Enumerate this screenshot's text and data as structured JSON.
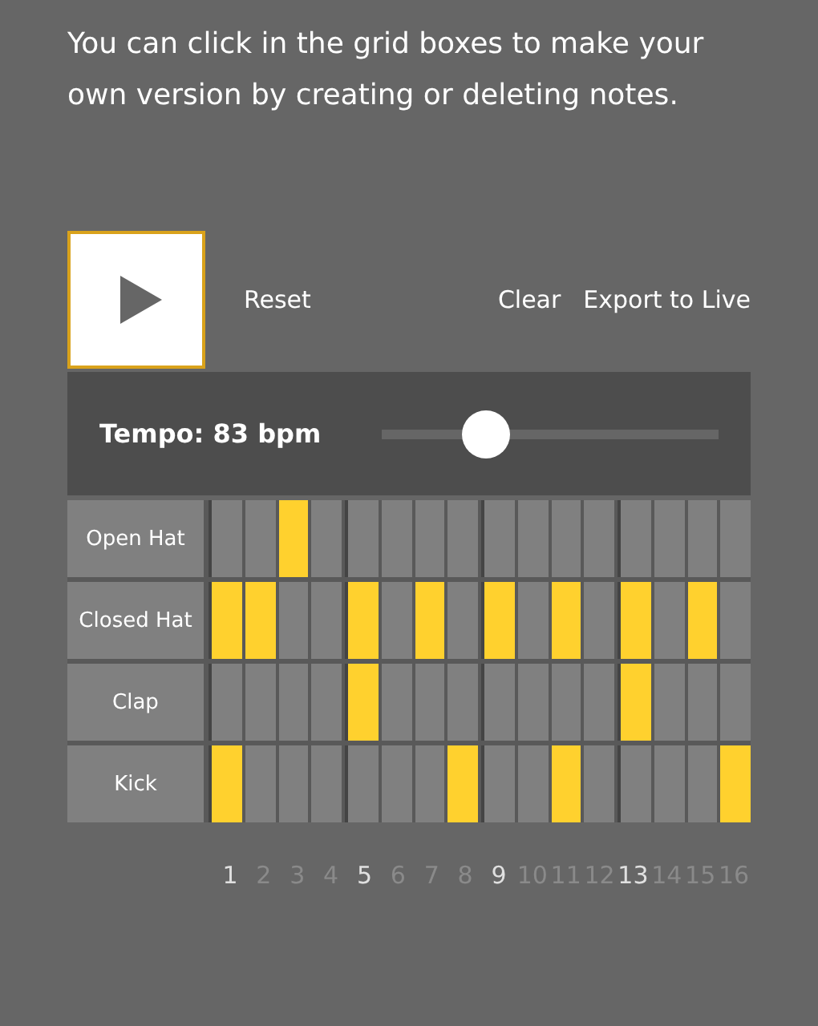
{
  "intro": "You can click in the grid boxes to make your own version by creating or deleting notes.",
  "toolbar": {
    "reset": "Reset",
    "clear": "Clear",
    "export": "Export to Live"
  },
  "tempo": {
    "label": "Tempo: 83 bpm",
    "level": 0.28
  },
  "tracks": [
    {
      "name": "Open Hat",
      "steps": [
        false,
        false,
        true,
        false,
        false,
        false,
        false,
        false,
        false,
        false,
        false,
        false,
        false,
        false,
        false,
        false
      ]
    },
    {
      "name": "Closed Hat",
      "steps": [
        true,
        true,
        false,
        false,
        true,
        false,
        true,
        false,
        true,
        false,
        true,
        false,
        true,
        false,
        true,
        false
      ]
    },
    {
      "name": "Clap",
      "steps": [
        false,
        false,
        false,
        false,
        true,
        false,
        false,
        false,
        false,
        false,
        false,
        false,
        true,
        false,
        false,
        false
      ]
    },
    {
      "name": "Kick",
      "steps": [
        true,
        false,
        false,
        false,
        false,
        false,
        false,
        true,
        false,
        false,
        true,
        false,
        false,
        false,
        false,
        true
      ]
    }
  ],
  "step_numbers": [
    {
      "label": "1",
      "emphasized": true
    },
    {
      "label": "2",
      "emphasized": false
    },
    {
      "label": "3",
      "emphasized": false
    },
    {
      "label": "4",
      "emphasized": false
    },
    {
      "label": "5",
      "emphasized": true
    },
    {
      "label": "6",
      "emphasized": false
    },
    {
      "label": "7",
      "emphasized": false
    },
    {
      "label": "8",
      "emphasized": false
    },
    {
      "label": "9",
      "emphasized": true
    },
    {
      "label": "10",
      "emphasized": false
    },
    {
      "label": "11",
      "emphasized": false
    },
    {
      "label": "12",
      "emphasized": false
    },
    {
      "label": "13",
      "emphasized": true
    },
    {
      "label": "14",
      "emphasized": false
    },
    {
      "label": "15",
      "emphasized": false
    },
    {
      "label": "16",
      "emphasized": false
    }
  ]
}
